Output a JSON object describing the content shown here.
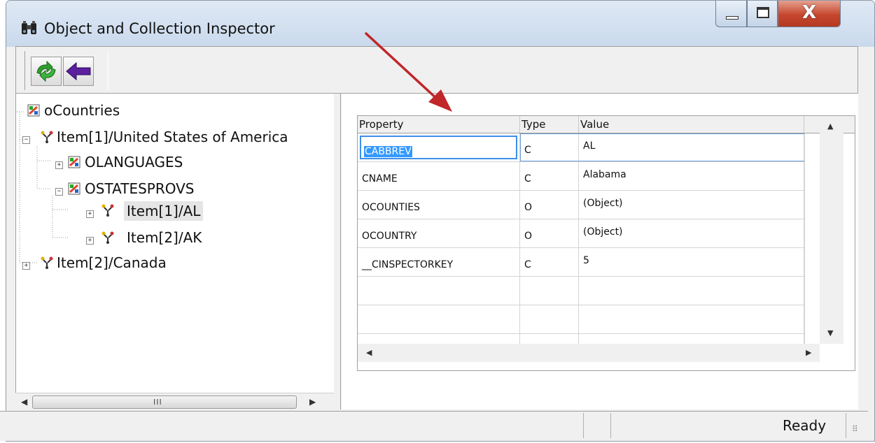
{
  "window": {
    "title": "Object and Collection Inspector",
    "icon": "binoculars-icon"
  },
  "title_buttons": {
    "minimize_icon": "minimize-icon",
    "maximize_icon": "maximize-icon",
    "close_glyph": "X"
  },
  "toolbar": {
    "refresh_icon": "refresh-icon",
    "back_icon": "back-arrow-icon"
  },
  "tree": {
    "nodes": [
      {
        "label": "oCountries",
        "icon": "collection-icon",
        "expander": ""
      },
      {
        "label": "Item[1]/United States of America",
        "icon": "object-icon",
        "expander": "−"
      },
      {
        "label": "OLANGUAGES",
        "icon": "collection-icon",
        "expander": "+"
      },
      {
        "label": "OSTATESPROVS",
        "icon": "collection-icon",
        "expander": "−"
      },
      {
        "label": "Item[1]/AL",
        "icon": "object-icon",
        "expander": "+"
      },
      {
        "label": "Item[2]/AK",
        "icon": "object-icon",
        "expander": "+"
      },
      {
        "label": "Item[2]/Canada",
        "icon": "object-icon",
        "expander": "+"
      }
    ],
    "scrollbar": {
      "left": "◀",
      "right": "▶",
      "grip": "III"
    }
  },
  "grid": {
    "columns": [
      "Property",
      "Type",
      "Value"
    ],
    "rows": [
      {
        "property": "CABBREV",
        "type": "C",
        "value": "AL"
      },
      {
        "property": "CNAME",
        "type": "C",
        "value": "Alabama"
      },
      {
        "property": "OCOUNTIES",
        "type": "O",
        "value": "(Object)"
      },
      {
        "property": "OCOUNTRY",
        "type": "O",
        "value": "(Object)"
      },
      {
        "property": "__CINSPECTORKEY",
        "type": "C",
        "value": "5"
      }
    ],
    "scroll": {
      "up": "▲",
      "down": "▼",
      "left": "◀",
      "right": "▶"
    }
  },
  "status": {
    "text": "Ready",
    "grip": "⠿"
  },
  "colors": {
    "selection": "#3399ff",
    "annotation_arrow": "#c0262a"
  }
}
